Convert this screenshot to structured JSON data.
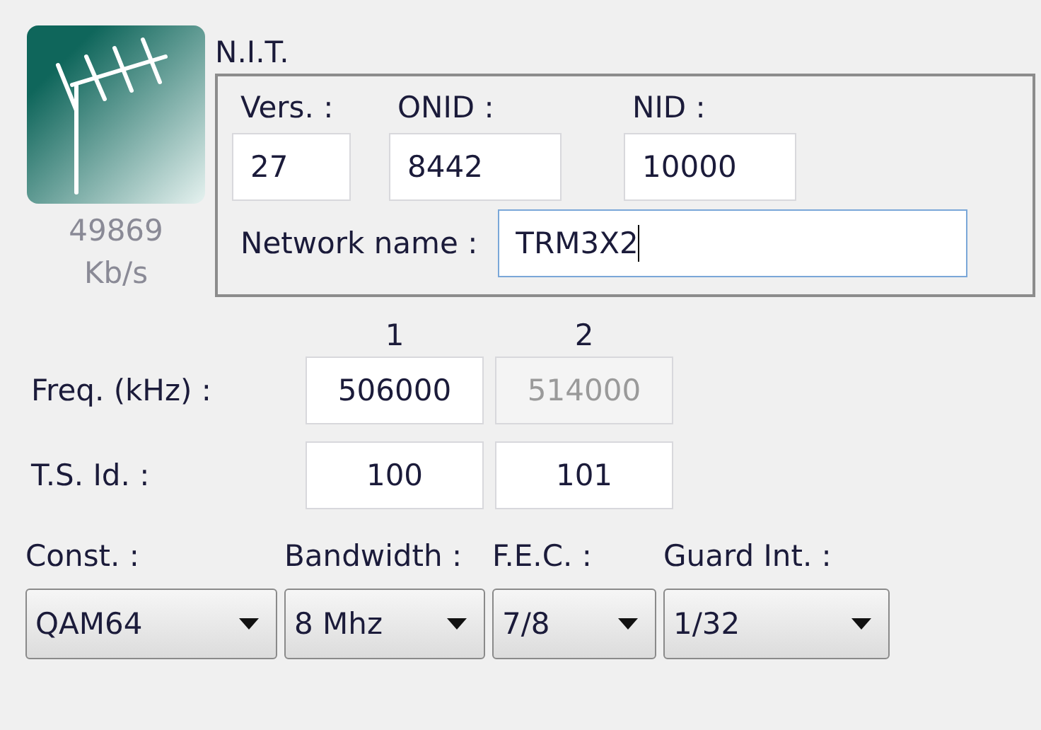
{
  "bitrate": {
    "value": "49869",
    "unit": "Kb/s"
  },
  "nit": {
    "title": "N.I.T.",
    "fields": [
      {
        "label": "Vers. :",
        "value": "27"
      },
      {
        "label": "ONID :",
        "value": "8442"
      },
      {
        "label": "NID :",
        "value": "10000"
      }
    ],
    "network_name": {
      "label": "Network name :",
      "value": "TRM3X2",
      "focused": true
    }
  },
  "columns": [
    "1",
    "2"
  ],
  "rows": [
    {
      "label": "Freq. (kHz) :",
      "cells": [
        {
          "value": "506000",
          "disabled": false
        },
        {
          "value": "514000",
          "disabled": true
        }
      ]
    },
    {
      "label": "T.S. Id. :",
      "cells": [
        {
          "value": "100",
          "disabled": false
        },
        {
          "value": "101",
          "disabled": false
        }
      ]
    }
  ],
  "dropdowns": [
    {
      "label": "Const. :",
      "value": "QAM64"
    },
    {
      "label": "Bandwidth :",
      "value": "8 Mhz"
    },
    {
      "label": "F.E.C. :",
      "value": "7/8"
    },
    {
      "label": "Guard Int. :",
      "value": "1/32"
    }
  ]
}
